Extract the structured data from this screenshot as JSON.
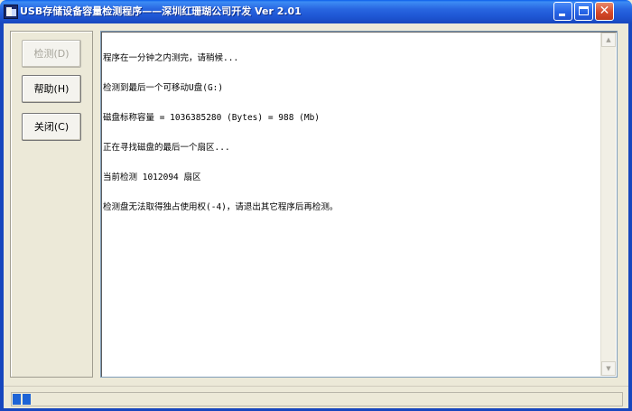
{
  "window": {
    "title": "USB存储设备容量检测程序——深圳红珊瑚公司开发 Ver 2.01",
    "close_glyph": "✕"
  },
  "buttons": {
    "detect": "检测(D)",
    "help": "帮助(H)",
    "close": "关闭(C)"
  },
  "output": {
    "lines": [
      "程序在一分钟之内测完，请稍候...",
      "检测到最后一个可移动U盘(G:)",
      "磁盘标称容量 = 1036385280 (Bytes) = 988 (Mb)",
      "正在寻找磁盘的最后一个扇区...",
      "当前检测 1012094 扇区",
      "检测盘无法取得独占使用权(-4)，请退出其它程序后再检测。"
    ]
  },
  "scrollbar": {
    "up_glyph": "▲",
    "down_glyph": "▼"
  },
  "statusbar": {
    "progress_blocks": 2
  },
  "colors": {
    "titlebar": "#2865E0",
    "progress": "#1e64d6",
    "window_bg": "#ECE9D8"
  }
}
